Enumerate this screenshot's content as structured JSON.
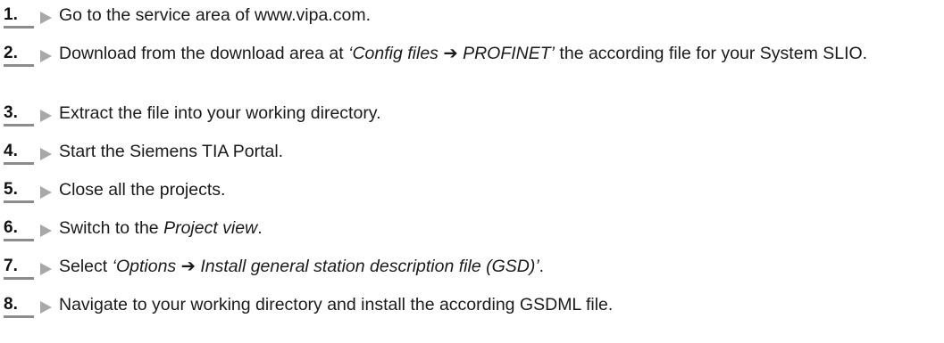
{
  "steps": [
    {
      "number": "1.",
      "parts": [
        {
          "text": "Go to the service area of www.vipa.com.",
          "italic": false
        }
      ]
    },
    {
      "number": "2.",
      "parts": [
        {
          "text": "Download from the download area at ",
          "italic": false
        },
        {
          "text": "‘Config files ➔ PROFINET’",
          "italic": true
        },
        {
          "text": " the according file for your System SLIO.",
          "italic": false
        }
      ]
    },
    {
      "number": "3.",
      "parts": [
        {
          "text": "Extract the file into your working directory.",
          "italic": false
        }
      ]
    },
    {
      "number": "4.",
      "parts": [
        {
          "text": "Start the Siemens TIA Portal.",
          "italic": false
        }
      ]
    },
    {
      "number": "5.",
      "parts": [
        {
          "text": "Close all the projects.",
          "italic": false
        }
      ]
    },
    {
      "number": "6.",
      "parts": [
        {
          "text": "Switch to the ",
          "italic": false
        },
        {
          "text": "Project view",
          "italic": true
        },
        {
          "text": ".",
          "italic": false
        }
      ]
    },
    {
      "number": "7.",
      "parts": [
        {
          "text": "Select ",
          "italic": false
        },
        {
          "text": "‘Options ➔ Install general station description file (GSD)’",
          "italic": true
        },
        {
          "text": ".",
          "italic": false
        }
      ]
    },
    {
      "number": "8.",
      "parts": [
        {
          "text": "Navigate to your working directory and install the according GSDML file.",
          "italic": false
        }
      ]
    }
  ]
}
